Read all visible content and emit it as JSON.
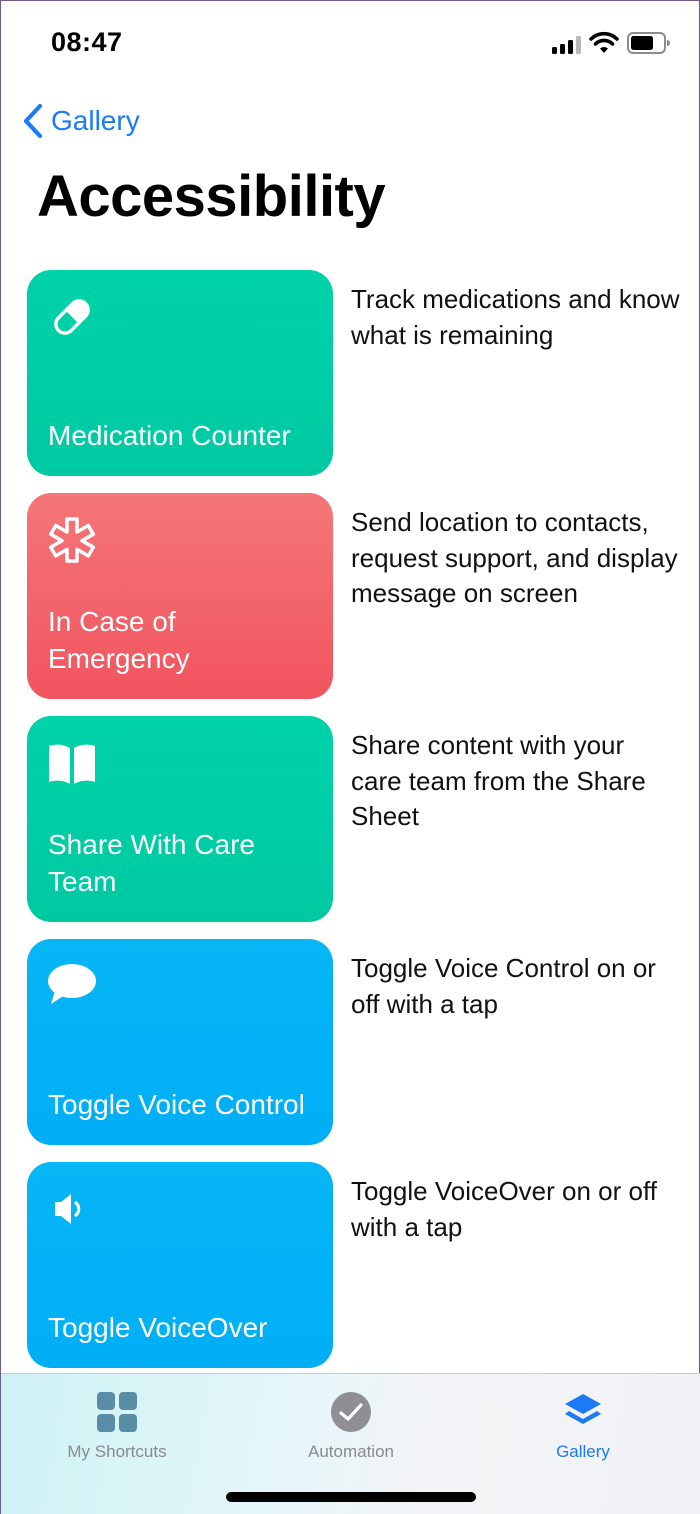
{
  "status_bar": {
    "time": "08:47",
    "icons": [
      "cellular-signal-icon",
      "wifi-icon",
      "battery-icon"
    ]
  },
  "nav": {
    "back_label": "Gallery",
    "back_icon": "chevron-left-icon",
    "accent_color": "#1a7bf5"
  },
  "page": {
    "title": "Accessibility"
  },
  "shortcuts": [
    {
      "title": "Medication Counter",
      "description": "Track medications and know what is remaining",
      "icon": "pill-icon",
      "color": "#00cfa5"
    },
    {
      "title": "In Case of Emergency",
      "description": "Send location to contacts, request support, and display message on screen",
      "icon": "medical-star-icon",
      "color": "#f2606a"
    },
    {
      "title": "Share With Care Team",
      "description": "Share content with your care team from the Share Sheet",
      "icon": "book-icon",
      "color": "#00cfa5"
    },
    {
      "title": "Toggle Voice Control",
      "description": "Toggle Voice Control on or off with a tap",
      "icon": "speech-bubble-icon",
      "color": "#00b3f6"
    },
    {
      "title": "Toggle VoiceOver",
      "description": "Toggle VoiceOver on or off with a tap",
      "icon": "speaker-icon",
      "color": "#00b3f6"
    }
  ],
  "tab_bar": {
    "tabs": [
      {
        "label": "My Shortcuts",
        "icon": "grid-icon",
        "active": false
      },
      {
        "label": "Automation",
        "icon": "clock-check-icon",
        "active": false
      },
      {
        "label": "Gallery",
        "icon": "layers-icon",
        "active": true
      }
    ]
  }
}
